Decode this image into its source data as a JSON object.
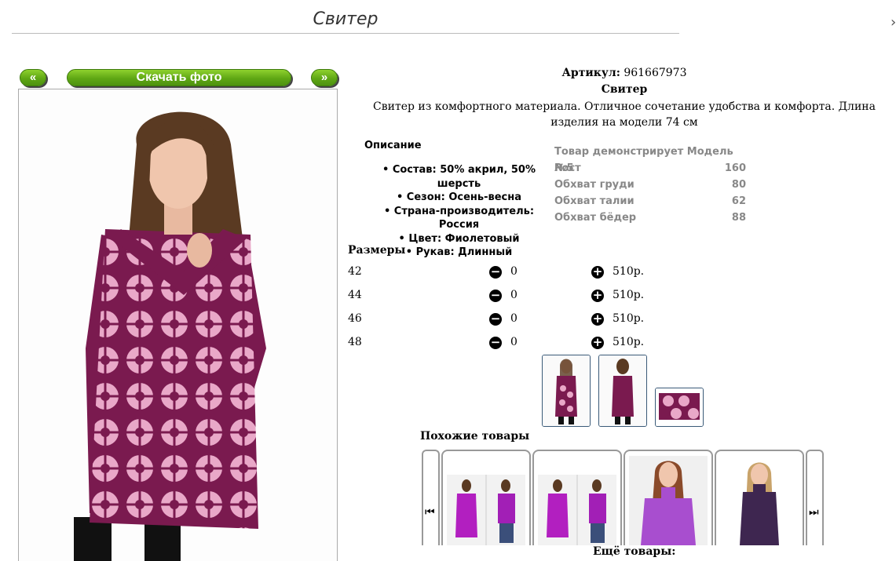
{
  "page": {
    "title": "Свитер",
    "corner_mark": "›"
  },
  "nav": {
    "prev_label": "«",
    "download_label": "Скачать фото",
    "next_label": "»"
  },
  "product": {
    "article_label": "Артикул:",
    "article_value": "961667973",
    "name": "Свитер",
    "description": "Свитер из комфортного материала. Отличное сочетание удобства и комфорта. Длина изделия на модели 74 см"
  },
  "details": {
    "heading": "Описание",
    "items": [
      "Состав: 50% акрил, 50% шерсть",
      "Сезон: Осень-весна",
      "Страна-производитель: Россия",
      "Цвет: Фиолетовый",
      "Рукав: Длинный"
    ]
  },
  "model": {
    "heading": "Товар демонстрирует Модель №5",
    "rows": [
      {
        "label": "Рост",
        "value": "160"
      },
      {
        "label": "Обхват груди",
        "value": "80"
      },
      {
        "label": "Обхват талии",
        "value": "62"
      },
      {
        "label": "Обхват бёдер",
        "value": "88"
      }
    ]
  },
  "sizes": {
    "heading": "Размеры",
    "rows": [
      {
        "size": "42",
        "qty": "0",
        "price": "510р."
      },
      {
        "size": "44",
        "qty": "0",
        "price": "510р."
      },
      {
        "size": "46",
        "qty": "0",
        "price": "510р."
      },
      {
        "size": "48",
        "qty": "0",
        "price": "510р."
      }
    ],
    "minus_glyph": "−",
    "plus_glyph": "+"
  },
  "similar": {
    "heading": "Похожие товары",
    "prev_glyph": "⏮",
    "next_glyph": "⏭"
  },
  "more": {
    "heading": "Ещё товары:"
  },
  "colors": {
    "accent_green": "#5fa714",
    "sweater": "#7a1a4f",
    "pattern": "#e9a8c8"
  }
}
